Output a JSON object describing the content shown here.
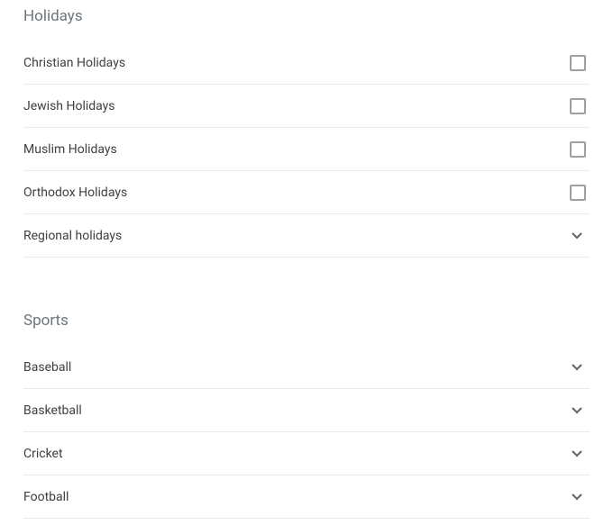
{
  "sections": {
    "holidays": {
      "header": "Holidays",
      "items": [
        {
          "label": "Christian Holidays",
          "type": "checkbox"
        },
        {
          "label": "Jewish Holidays",
          "type": "checkbox"
        },
        {
          "label": "Muslim Holidays",
          "type": "checkbox"
        },
        {
          "label": "Orthodox Holidays",
          "type": "checkbox"
        },
        {
          "label": "Regional holidays",
          "type": "expand"
        }
      ]
    },
    "sports": {
      "header": "Sports",
      "items": [
        {
          "label": "Baseball",
          "type": "expand"
        },
        {
          "label": "Basketball",
          "type": "expand"
        },
        {
          "label": "Cricket",
          "type": "expand"
        },
        {
          "label": "Football",
          "type": "expand"
        }
      ]
    }
  }
}
